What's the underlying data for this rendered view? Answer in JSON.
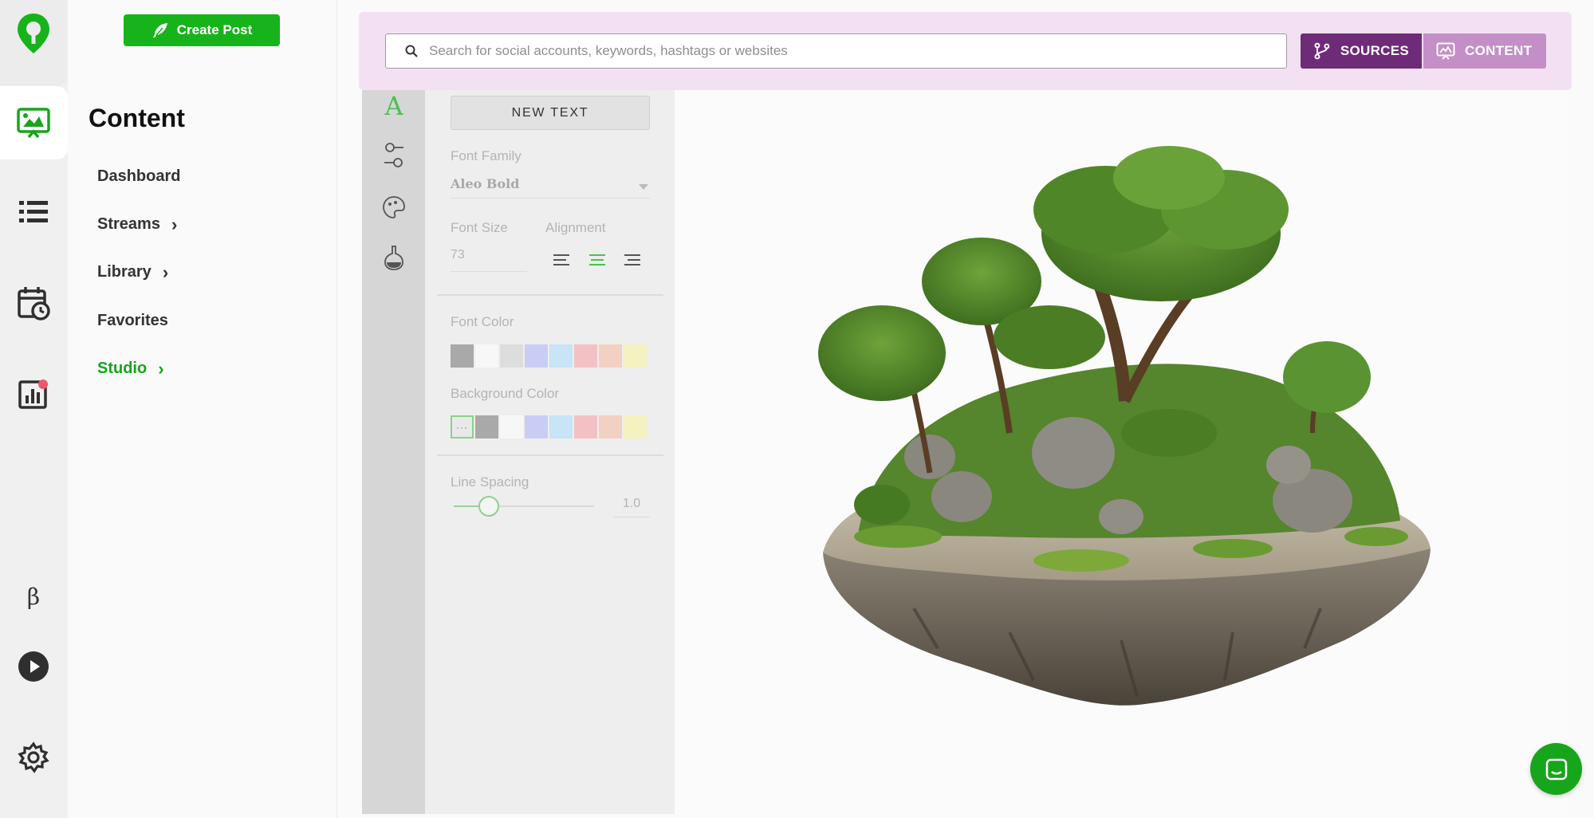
{
  "rail": {
    "icons": [
      "location-pin-logo-icon",
      "content-image-icon",
      "list-icon",
      "calendar-clock-icon",
      "analytics-chart-icon",
      "beta-icon",
      "play-icon",
      "gear-icon"
    ],
    "beta_label": "β",
    "brand_color": "#17b31b",
    "notification_color": "#f0566a"
  },
  "sidenav": {
    "create_post_label": "Create Post",
    "title": "Content",
    "items": [
      {
        "label": "Dashboard",
        "has_chevron": false,
        "active": false
      },
      {
        "label": "Streams",
        "has_chevron": true,
        "active": false
      },
      {
        "label": "Library",
        "has_chevron": true,
        "active": false
      },
      {
        "label": "Favorites",
        "has_chevron": false,
        "active": false
      },
      {
        "label": "Studio",
        "has_chevron": true,
        "active": true
      }
    ],
    "chevron": "›"
  },
  "topbar": {
    "search_placeholder": "Search for social accounts, keywords, hashtags or websites",
    "sources_label": "SOURCES",
    "content_label": "CONTENT",
    "sources_color": "#6e2b78",
    "content_color": "#c38fc6"
  },
  "studio": {
    "tools": [
      "text-tool-icon",
      "adjust-tool-icon",
      "sticker-tool-icon",
      "filter-tool-icon"
    ],
    "text_tool_glyph": "A",
    "new_text_label": "NEW TEXT",
    "font_family_label": "Font Family",
    "font_family_value": "Aleo Bold",
    "font_size_label": "Font Size",
    "font_size_value": "73",
    "alignment_label": "Alignment",
    "alignment_selected": "center",
    "font_color_label": "Font Color",
    "font_colors": [
      "#a9a9a9",
      "#f7f7f7",
      "#dddddd",
      "#c9cdf6",
      "#c8e4f6",
      "#f3c1c4",
      "#f3d1c2",
      "#f5f1c0"
    ],
    "background_color_label": "Background Color",
    "background_none_glyph": "···",
    "background_colors": [
      "#a9a9a9",
      "#f7f7f7",
      "#c9cdf6",
      "#c8e4f6",
      "#f3c1c4",
      "#f3d1c2",
      "#f5f1c0"
    ],
    "line_spacing_label": "Line Spacing",
    "line_spacing_value": "1.0",
    "line_spacing_fraction": 0.2
  }
}
